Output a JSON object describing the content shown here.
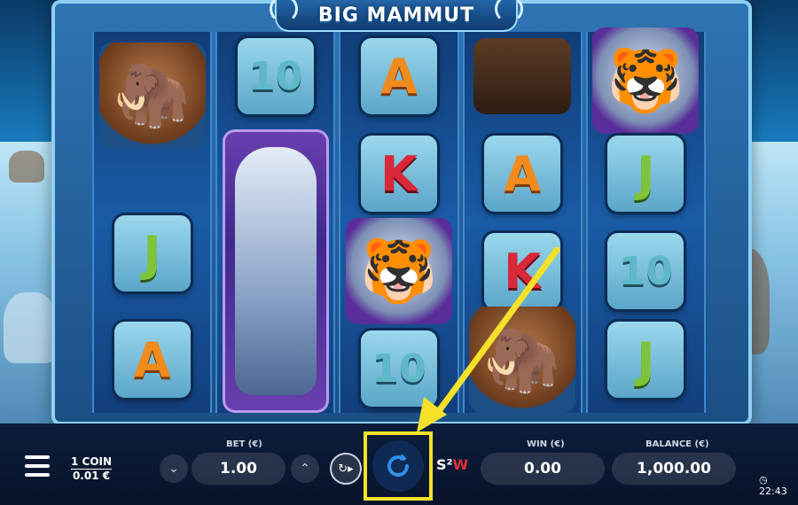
{
  "game": {
    "title": "BIG MAMMUT"
  },
  "reels": [
    {
      "symbols": [
        "mammoth",
        "J",
        "A"
      ]
    },
    {
      "symbols": [
        "10",
        "tiger-tall"
      ]
    },
    {
      "symbols": [
        "A",
        "K",
        "tiger",
        "10"
      ]
    },
    {
      "symbols": [
        "boots",
        "A",
        "K",
        "mammoth"
      ]
    },
    {
      "symbols": [
        "tiger",
        "J",
        "10",
        "J"
      ]
    }
  ],
  "controls": {
    "coin_line1": "1 COIN",
    "coin_line2": "0.01 €",
    "bet_label": "BET (€)",
    "bet_value": "1.00",
    "win_label": "WIN (€)",
    "win_value": "0.00",
    "balance_label": "BALANCE (€)",
    "balance_value": "1,000.00",
    "brand_text": "S²W",
    "clock": "22:43"
  },
  "icons": {
    "menu": "hamburger-icon",
    "bet_down": "chevron-down-icon",
    "bet_up": "chevron-up-icon",
    "autoplay": "autoplay-icon",
    "spin": "spin-refresh-icon",
    "clock": "clock-icon"
  },
  "colors": {
    "highlight": "#f5e12a",
    "accent_blue": "#1b70b8"
  }
}
